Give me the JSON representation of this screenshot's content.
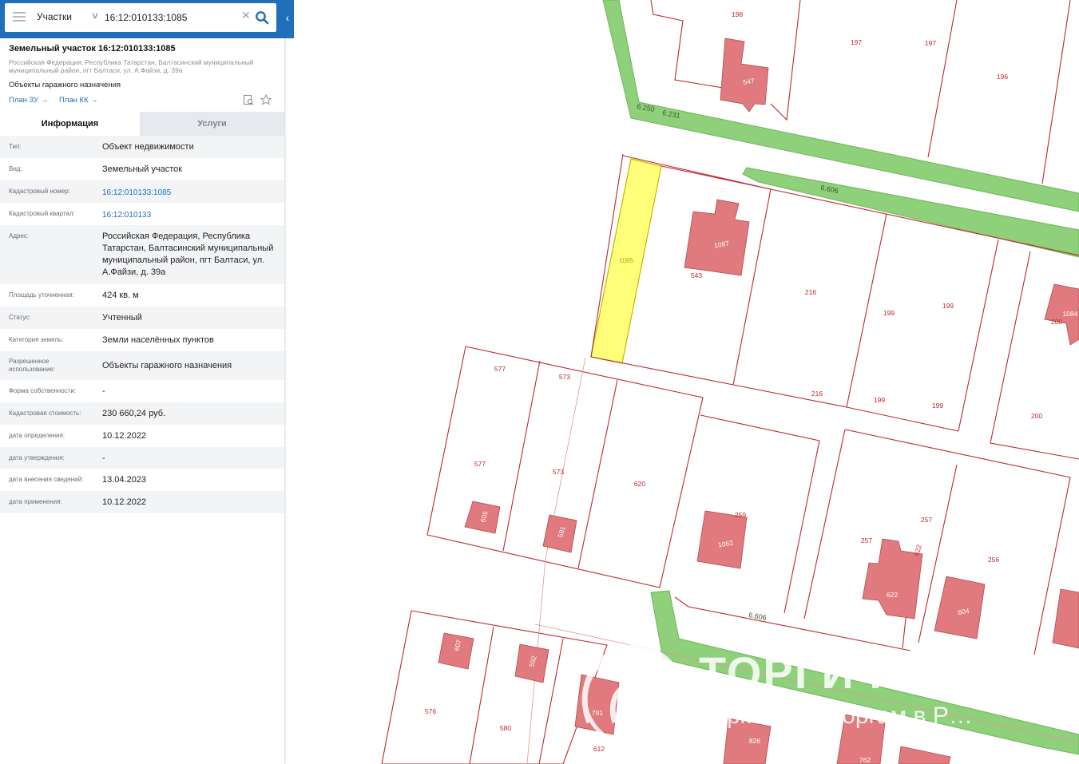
{
  "search": {
    "layer": "Участки",
    "query": "16:12:010133:1085"
  },
  "object": {
    "title": "Земельный участок 16:12:010133:1085",
    "address": "Российская Федерация, Республика Татарстан, Балтасинский муниципальный муниципальный район, пгт Балтаси, ул. А.Файзи, д. 39а",
    "usage": "Объекты гаражного назначения",
    "plan_zu": "План ЗУ",
    "plan_kk": "План КК"
  },
  "tabs": {
    "info": "Информация",
    "services": "Услуги"
  },
  "rows": [
    {
      "label": "Тип:",
      "value": "Объект недвижимости"
    },
    {
      "label": "Вид:",
      "value": "Земельный участок"
    },
    {
      "label": "Кадастровый номер:",
      "value": "16:12:010133:1085",
      "link": true
    },
    {
      "label": "Кадастровый квартал:",
      "value": "16:12:010133",
      "link": true
    },
    {
      "label": "Адрес:",
      "value": "Российская Федерация, Республика Татарстан, Балтасинский муниципальный муниципальный район, пгт Балтаси, ул. А.Файзи, д. 39а"
    },
    {
      "label": "Площадь уточненная:",
      "value": "424 кв. м"
    },
    {
      "label": "Статус:",
      "value": "Учтенный"
    },
    {
      "label": "Категория земель:",
      "value": "Земли населённых пунктов"
    },
    {
      "label": "Разрешенное использование:",
      "value": "Объекты гаражного назначения"
    },
    {
      "label": "Форма собственности:",
      "value": "-"
    },
    {
      "label": "Кадастровая стоимость:",
      "value": "230 660,24 руб."
    },
    {
      "label": "дата определения:",
      "value": "10.12.2022"
    },
    {
      "label": "дата утверждения:",
      "value": "-"
    },
    {
      "label": "дата внесения сведений:",
      "value": "13.04.2023"
    },
    {
      "label": "дата применения:",
      "value": "10.12.2022"
    }
  ],
  "map": {
    "parcel_labels": [
      "198",
      "197",
      "197",
      "196",
      "547",
      "6.250",
      "6.231",
      "6.606",
      "1085",
      "1087",
      "543",
      "216",
      "199",
      "199",
      "1084",
      "200",
      "577",
      "573",
      "216",
      "199",
      "199",
      "200",
      "577",
      "573",
      "620",
      "605",
      "591",
      "259",
      "1062",
      "257",
      "257",
      "622",
      "622",
      "256",
      "604",
      "6.606",
      "607",
      "592",
      "576",
      "580",
      "791",
      "612",
      "826",
      "762"
    ],
    "watermark_title": "ТОРГИ РОССИИ",
    "watermark_subtitle": "…ркет…по торгам в Р…"
  },
  "colors": {
    "accent": "#1f6fba",
    "parcel_border": "#c0282d",
    "building_fill": "#e07a7e",
    "road_fill": "#8fd07a",
    "selected_parcel": "#ffff7a"
  }
}
